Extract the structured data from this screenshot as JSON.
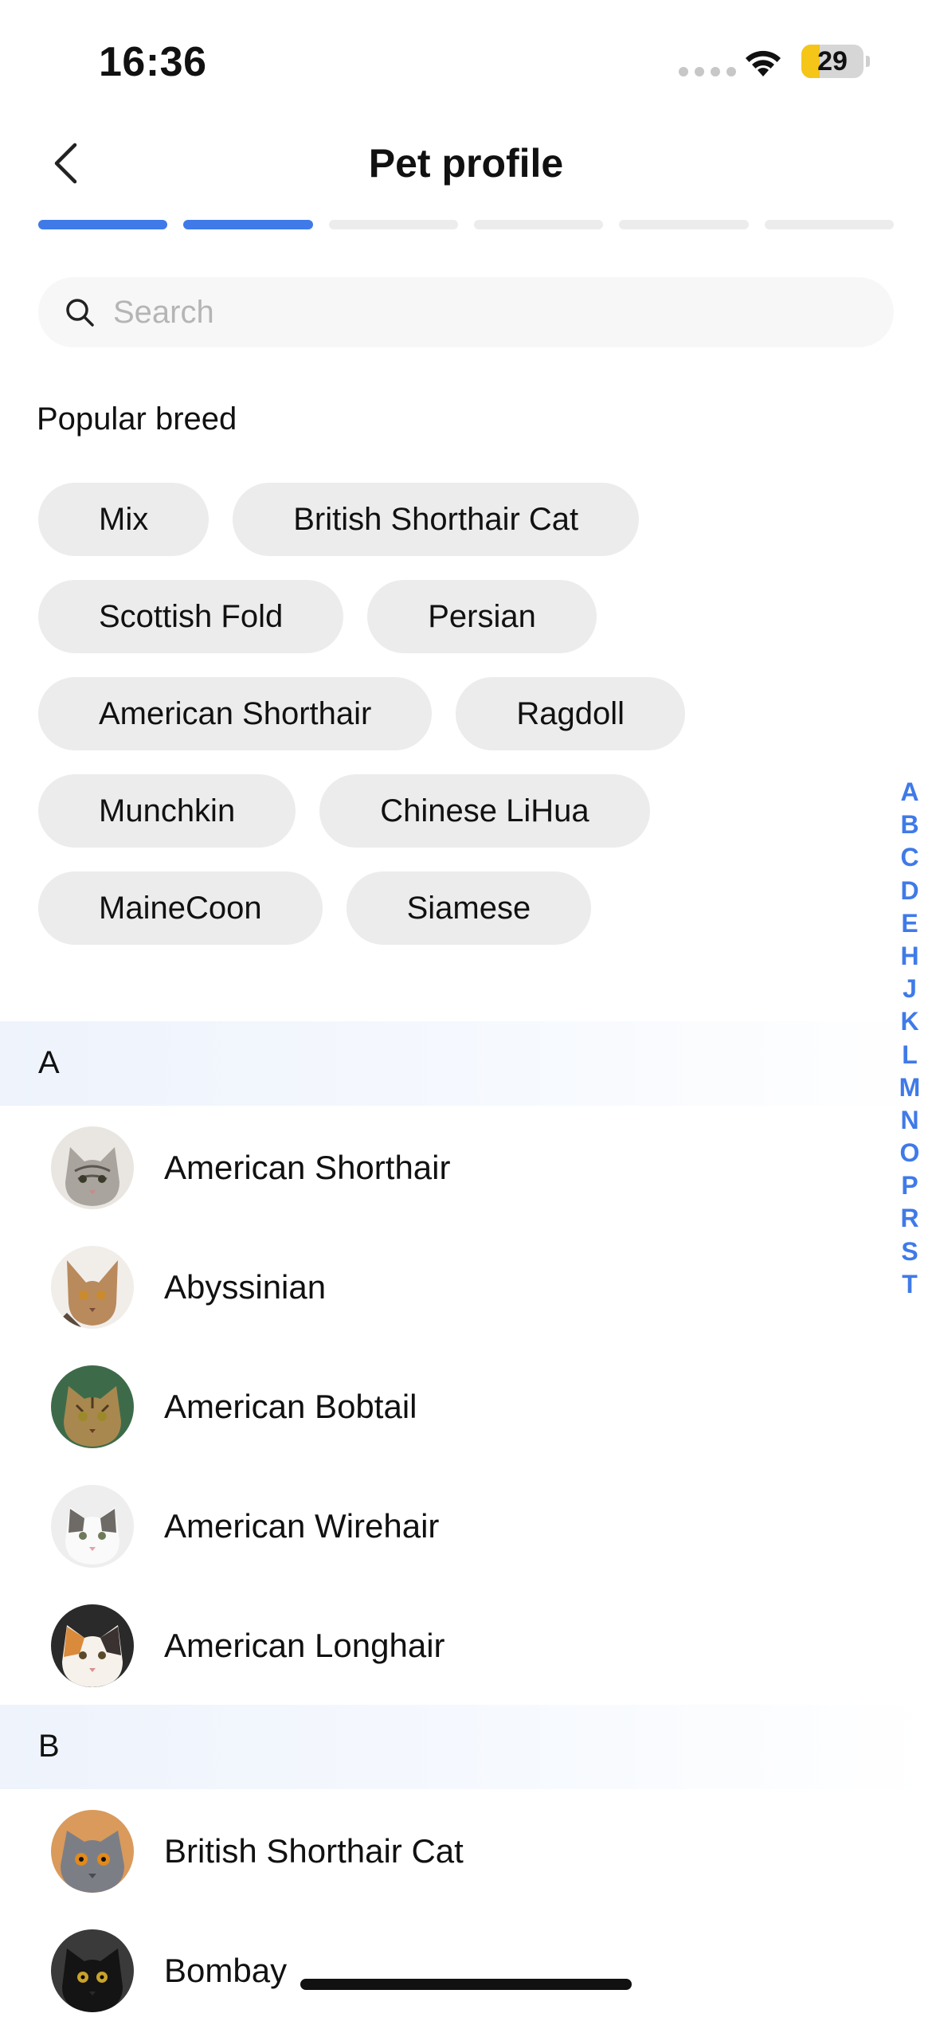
{
  "status_bar": {
    "time": "16:36",
    "battery": "29"
  },
  "header": {
    "title": "Pet profile"
  },
  "progress": {
    "total_steps": 6,
    "completed_steps": 2
  },
  "search": {
    "placeholder": "Search",
    "value": ""
  },
  "popular": {
    "title": "Popular breed",
    "chips": [
      "Mix",
      "British Shorthair Cat",
      "Scottish Fold",
      "Persian",
      "American Shorthair",
      "Ragdoll",
      "Munchkin",
      "Chinese LiHua",
      "MaineCoon",
      "Siamese"
    ]
  },
  "sections": [
    {
      "letter": "A",
      "items": [
        "American Shorthair",
        "Abyssinian",
        "American Bobtail",
        "American Wirehair",
        "American Longhair"
      ]
    },
    {
      "letter": "B",
      "items": [
        "British Shorthair Cat",
        "Bombay"
      ]
    }
  ],
  "index_letters": [
    "A",
    "B",
    "C",
    "D",
    "E",
    "H",
    "J",
    "K",
    "L",
    "M",
    "N",
    "O",
    "P",
    "R",
    "S",
    "T"
  ],
  "colors": {
    "accent": "#3f7ae8",
    "chip_bg": "#ececec",
    "section_header_bg": "#eef3fc"
  }
}
